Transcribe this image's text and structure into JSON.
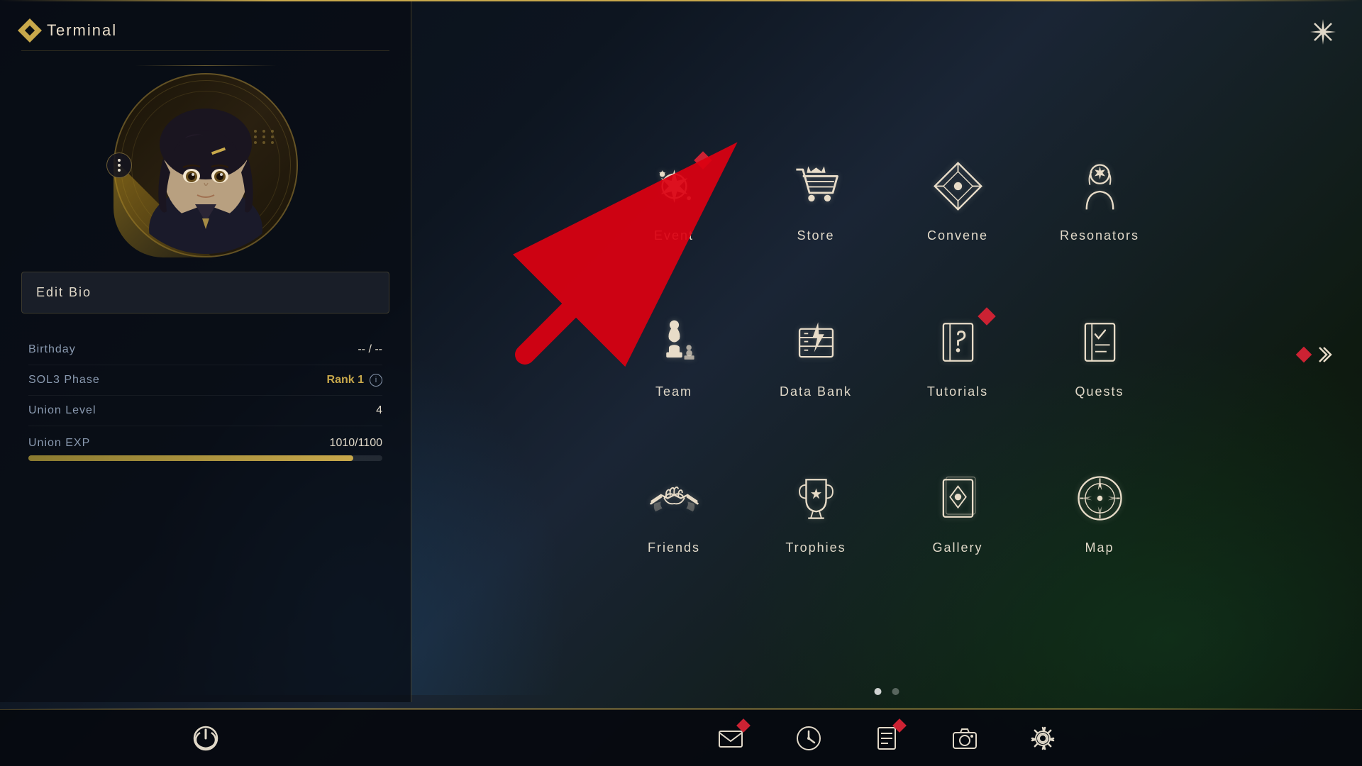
{
  "app": {
    "title": "Terminal",
    "close_label": "×"
  },
  "left_panel": {
    "terminal_icon": "diamond",
    "avatar": {
      "menu_label": "•••"
    },
    "edit_bio_label": "Edit Bio",
    "stats": {
      "birthday_label": "Birthday",
      "birthday_value": "-- / --",
      "sol3_label": "SOL3 Phase",
      "sol3_value": "Rank 1",
      "union_level_label": "Union Level",
      "union_level_value": "4",
      "union_exp_label": "Union EXP",
      "union_exp_value": "1010/1100",
      "union_exp_percent": 91.8
    }
  },
  "menu": {
    "items": [
      {
        "id": "event",
        "label": "Event",
        "icon": "event",
        "notif": true,
        "row": 1,
        "col": 1
      },
      {
        "id": "store",
        "label": "Store",
        "icon": "store",
        "notif": false,
        "row": 1,
        "col": 2
      },
      {
        "id": "convene",
        "label": "Convene",
        "icon": "convene",
        "notif": false,
        "row": 1,
        "col": 3
      },
      {
        "id": "resonators",
        "label": "Resonators",
        "icon": "resonators",
        "notif": false,
        "row": 1,
        "col": 4
      },
      {
        "id": "team",
        "label": "Team",
        "icon": "team",
        "notif": false,
        "row": 2,
        "col": 1
      },
      {
        "id": "databank",
        "label": "Data Bank",
        "icon": "databank",
        "notif": false,
        "row": 2,
        "col": 2
      },
      {
        "id": "tutorials",
        "label": "Tutorials",
        "icon": "tutorials",
        "notif": true,
        "row": 2,
        "col": 3
      },
      {
        "id": "quests",
        "label": "Quests",
        "icon": "quests",
        "notif": false,
        "row": 2,
        "col": 4
      },
      {
        "id": "friends",
        "label": "Friends",
        "icon": "friends",
        "notif": false,
        "row": 3,
        "col": 1
      },
      {
        "id": "trophies",
        "label": "Trophies",
        "icon": "trophies",
        "notif": false,
        "row": 3,
        "col": 2
      },
      {
        "id": "gallery",
        "label": "Gallery",
        "icon": "gallery",
        "notif": false,
        "row": 3,
        "col": 3
      },
      {
        "id": "map",
        "label": "Map",
        "icon": "map",
        "notif": false,
        "row": 3,
        "col": 4
      }
    ],
    "page_dots": [
      {
        "active": true
      },
      {
        "active": false
      }
    ]
  },
  "bottom_bar": {
    "icons": [
      {
        "id": "mail",
        "notif": true
      },
      {
        "id": "clock",
        "notif": false
      },
      {
        "id": "notes",
        "notif": true
      },
      {
        "id": "camera",
        "notif": false
      },
      {
        "id": "settings",
        "notif": false
      }
    ]
  },
  "colors": {
    "gold": "#c8a84b",
    "notif_red": "#cc2233",
    "text_main": "#e0d8c8",
    "text_dim": "#8a9ab0",
    "bg_panel": "rgba(8,12,20,0.75)"
  }
}
